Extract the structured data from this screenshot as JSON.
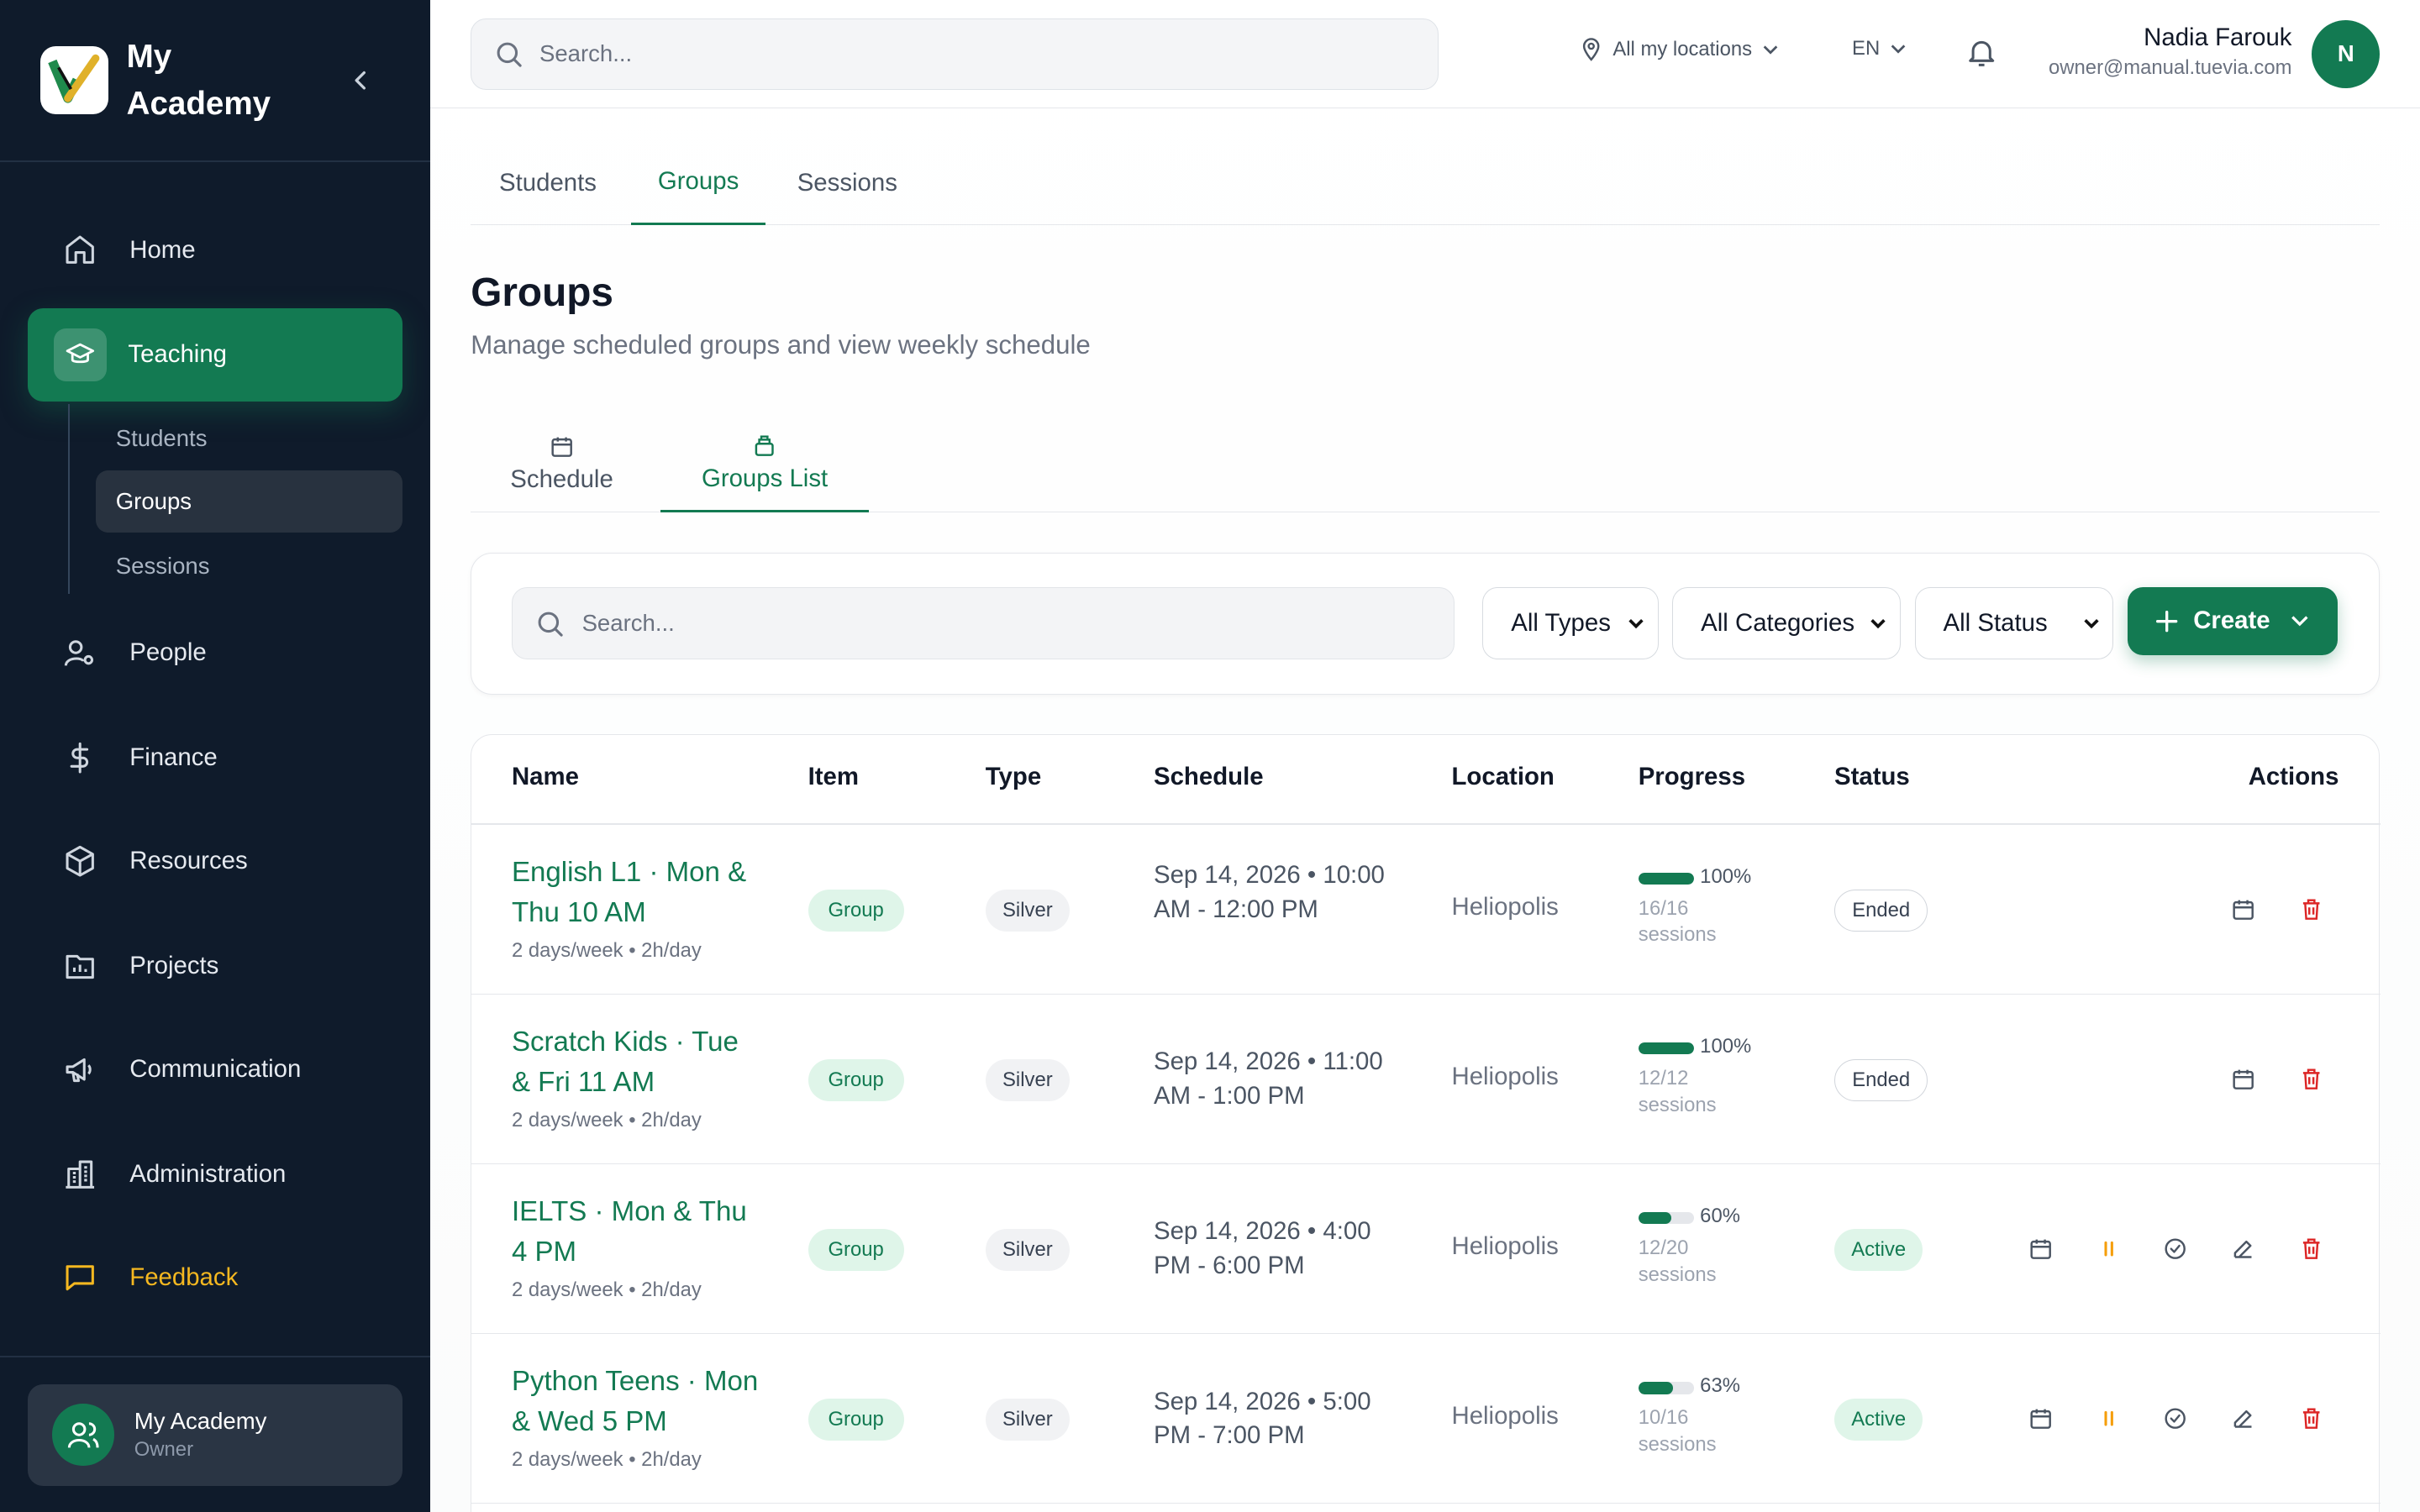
{
  "app": {
    "name": "My Academy"
  },
  "sidebar": {
    "nav": [
      {
        "label": "Home",
        "icon": "home-icon"
      },
      {
        "label": "Teaching",
        "icon": "graduation-cap-icon"
      },
      {
        "label": "People",
        "icon": "user-gear-icon"
      },
      {
        "label": "Finance",
        "icon": "dollar-icon"
      },
      {
        "label": "Resources",
        "icon": "box-icon"
      },
      {
        "label": "Projects",
        "icon": "chart-folder-icon"
      },
      {
        "label": "Communication",
        "icon": "megaphone-icon"
      },
      {
        "label": "Administration",
        "icon": "building-icon"
      },
      {
        "label": "Feedback",
        "icon": "chat-icon"
      }
    ],
    "teaching_sub": [
      "Students",
      "Groups",
      "Sessions"
    ],
    "account": {
      "name": "My Academy",
      "role": "Owner"
    }
  },
  "topbar": {
    "search_placeholder": "Search...",
    "location": "All my locations",
    "language": "EN",
    "user_name": "Nadia Farouk",
    "user_email": "owner@manual.tuevia.com",
    "avatar_letter": "N"
  },
  "tabs": [
    "Students",
    "Groups",
    "Sessions"
  ],
  "page": {
    "title": "Groups",
    "subtitle": "Manage scheduled groups and view weekly schedule"
  },
  "view_tabs": [
    "Schedule",
    "Groups List"
  ],
  "filters": {
    "search_placeholder": "Search...",
    "type": "All Types",
    "category": "All Categories",
    "status": "All Status",
    "create_label": "Create"
  },
  "table": {
    "columns": [
      "Name",
      "Item",
      "Type",
      "Schedule",
      "Location",
      "Progress",
      "Status",
      "Actions"
    ],
    "rows": [
      {
        "name": "English L1 · Mon & Thu 10 AM",
        "meta": "2 days/week • 2h/day",
        "item": "Group",
        "type": "Silver",
        "schedule": "Sep 14, 2026 • 10:00 AM - 12:00 PM",
        "location": "Heliopolis",
        "progress": 100,
        "progress_label": "100%",
        "sessions": "16/16 sessions",
        "status": "Ended"
      },
      {
        "name": "Scratch Kids · Tue & Fri 11 AM",
        "meta": "2 days/week • 2h/day",
        "item": "Group",
        "type": "Silver",
        "schedule": "Sep 14, 2026 • 11:00 AM - 1:00 PM",
        "location": "Heliopolis",
        "progress": 100,
        "progress_label": "100%",
        "sessions": "12/12 sessions",
        "status": "Ended"
      },
      {
        "name": "IELTS · Mon & Thu 4 PM",
        "meta": "2 days/week • 2h/day",
        "item": "Group",
        "type": "Silver",
        "schedule": "Sep 14, 2026 • 4:00 PM - 6:00 PM",
        "location": "Heliopolis",
        "progress": 60,
        "progress_label": "60%",
        "sessions": "12/20 sessions",
        "status": "Active"
      },
      {
        "name": "Python Teens · Mon & Wed 5 PM",
        "meta": "2 days/week • 2h/day",
        "item": "Group",
        "type": "Silver",
        "schedule": "Sep 14, 2026 • 5:00 PM - 7:00 PM",
        "location": "Heliopolis",
        "progress": 63,
        "progress_label": "63%",
        "sessions": "10/16 sessions",
        "status": "Active"
      }
    ]
  },
  "colors": {
    "brand": "#137a52",
    "sidebar_bg": "#0f1b2b",
    "feedback": "#f5b820",
    "danger": "#dc2626",
    "pause": "#f59e0b"
  }
}
